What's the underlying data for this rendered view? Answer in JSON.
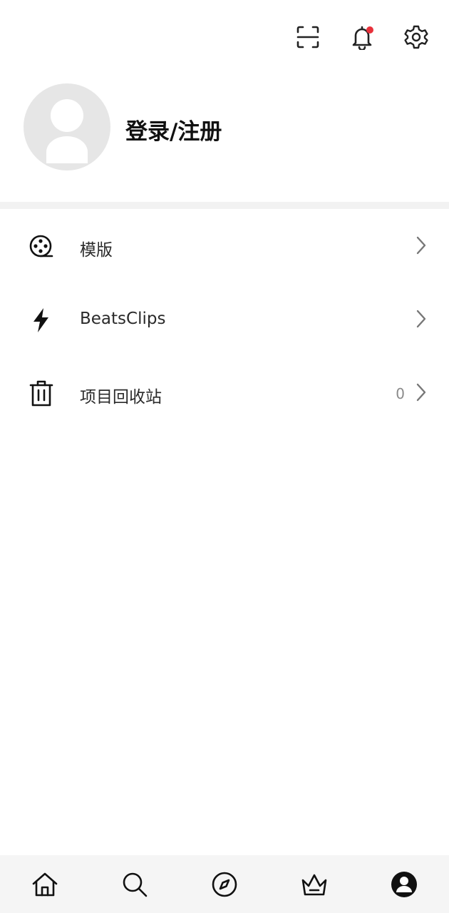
{
  "header": {
    "icons": [
      "scan-icon",
      "notification-bell-icon",
      "settings-gear-icon"
    ],
    "notification_dot_color": "#e8313b"
  },
  "profile": {
    "login_label": "登录/注册",
    "avatar_color": "#e6e6e6"
  },
  "menu": {
    "items": [
      {
        "label": "模版",
        "icon": "film-reel-icon",
        "count": ""
      },
      {
        "label": "BeatsClips",
        "icon": "lightning-bolt-icon",
        "count": ""
      },
      {
        "label": "项目回收站",
        "icon": "trash-can-icon",
        "count": "0"
      }
    ]
  },
  "bottom_nav": {
    "items": [
      "home-icon",
      "search-icon",
      "compass-icon",
      "crown-icon",
      "profile-icon"
    ],
    "active": "profile-icon"
  }
}
